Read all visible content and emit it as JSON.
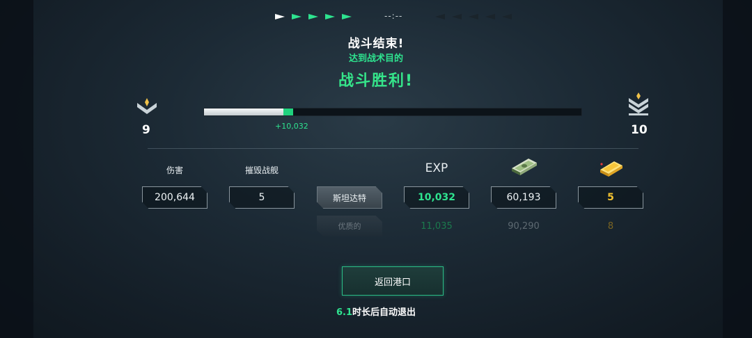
{
  "header": {
    "timer": "--:--",
    "team_indicators": {
      "left_colors": [
        "#ffffff",
        "#2ee38f",
        "#2ee38f",
        "#2ee38f",
        "#2ee38f"
      ],
      "right_colors": [
        "#1a242b",
        "#1a242b",
        "#1a242b",
        "#1a242b",
        "#1a242b"
      ]
    }
  },
  "result": {
    "title": "战斗结束!",
    "subtitle": "达到战术目的",
    "victory": "战斗胜利!"
  },
  "progress": {
    "current_level": "9",
    "next_level": "10",
    "gain_label": "+10,032",
    "fill_fraction": 0.21,
    "gain_fraction": 0.025,
    "rank_icons": [
      "rank-chevron-icon",
      "rank-double-chevron-icon"
    ]
  },
  "stats": {
    "damage_label": "伤害",
    "destroyed_label": "摧毁战舰",
    "exp_label": "EXP",
    "icons": [
      "cash-icon",
      "gold-bar-icon"
    ],
    "row1": {
      "damage": "200,644",
      "destroyed": "5",
      "tier": "斯坦达特",
      "exp": "10,032",
      "credits": "60,193",
      "gold": "5"
    },
    "row2": {
      "tier": "优质的",
      "exp": "11,035",
      "credits": "90,290",
      "gold": "8"
    }
  },
  "footer": {
    "return_button": "返回港口",
    "countdown": "6.1",
    "auto_exit_text": "时长后自动退出"
  },
  "colors": {
    "accent_green": "#2ee38f",
    "gold": "#f2c230"
  }
}
